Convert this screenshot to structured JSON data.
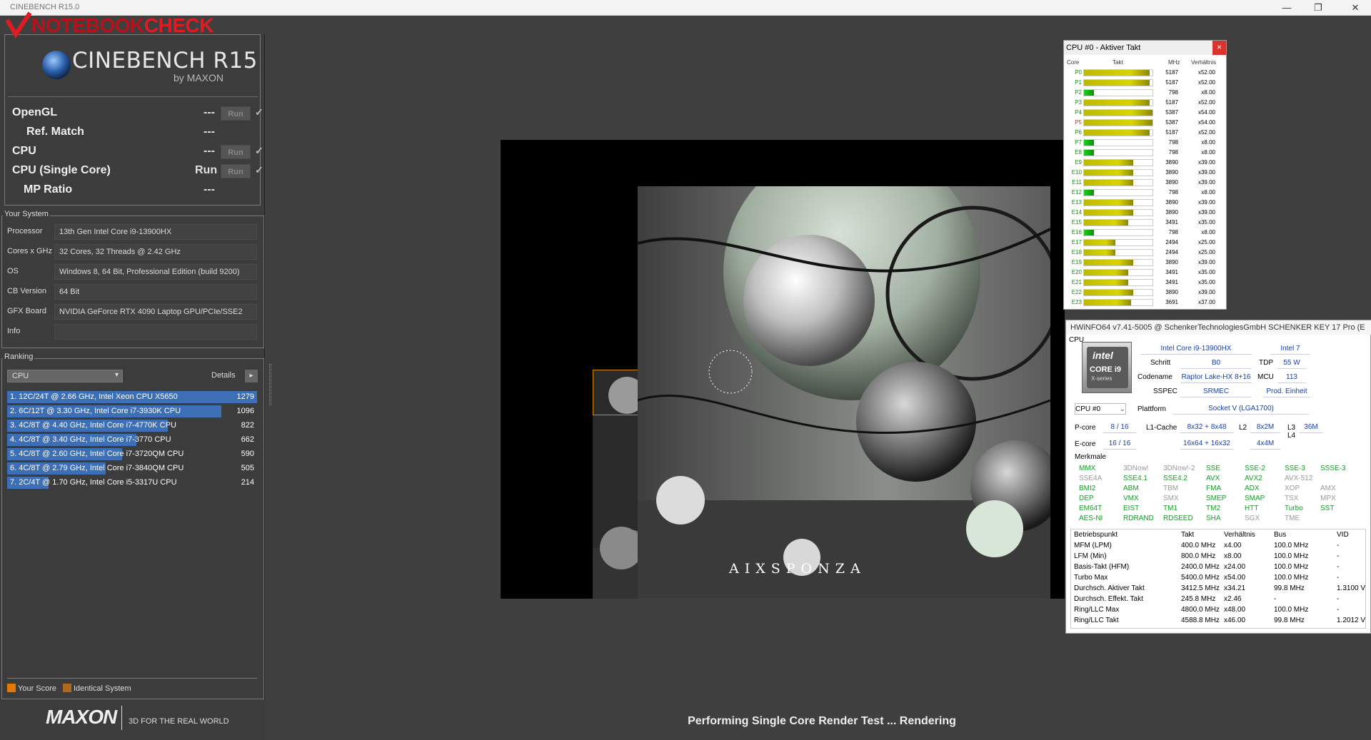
{
  "window": {
    "title": "CINEBENCH R15.0",
    "minimize": "—",
    "maximize": "❐",
    "close": "✕"
  },
  "watermark": {
    "text_a": "NOTEBOOK",
    "text_b": "CHECK"
  },
  "cinebench": {
    "title": "CINEBENCH R15",
    "subtitle": "by MAXON",
    "tests": [
      {
        "name": "OpenGL",
        "value": "---",
        "run": "Run"
      },
      {
        "name": "Ref. Match",
        "value": "---"
      },
      {
        "name": "CPU",
        "value": "---",
        "run": "Run"
      },
      {
        "name": "CPU (Single Core)",
        "value": "Run",
        "run": "Run"
      },
      {
        "name": "MP Ratio",
        "value": "---"
      }
    ],
    "check": "✓"
  },
  "your_system": {
    "label": "Your System",
    "rows": [
      {
        "k": "Processor",
        "v": "13th Gen Intel Core i9-13900HX"
      },
      {
        "k": "Cores x GHz",
        "v": "32 Cores, 32 Threads @ 2.42 GHz"
      },
      {
        "k": "OS",
        "v": "Windows 8, 64 Bit, Professional Edition (build 9200)"
      },
      {
        "k": "CB Version",
        "v": "64 Bit"
      },
      {
        "k": "GFX Board",
        "v": "NVIDIA GeForce RTX 4090 Laptop GPU/PCIe/SSE2"
      },
      {
        "k": "Info",
        "v": ""
      }
    ]
  },
  "ranking": {
    "label": "Ranking",
    "select": "CPU",
    "details": "Details",
    "rows": [
      {
        "text": "1. 12C/24T @ 2.66 GHz, Intel Xeon CPU X5650",
        "score": "1279",
        "fill": 1.0
      },
      {
        "text": "2. 6C/12T @ 3.30 GHz,  Intel Core i7-3930K CPU",
        "score": "1096",
        "fill": 0.857
      },
      {
        "text": "3. 4C/8T @ 4.40 GHz, Intel Core i7-4770K CPU",
        "score": "822",
        "fill": 0.643
      },
      {
        "text": "4. 4C/8T @ 3.40 GHz,  Intel Core i7-3770 CPU",
        "score": "662",
        "fill": 0.518
      },
      {
        "text": "5. 4C/8T @ 2.60 GHz, Intel Core i7-3720QM CPU",
        "score": "590",
        "fill": 0.461
      },
      {
        "text": "6. 4C/8T @ 2.79 GHz,  Intel Core i7-3840QM CPU",
        "score": "505",
        "fill": 0.395
      },
      {
        "text": "7. 2C/4T @ 1.70 GHz,  Intel Core i5-3317U CPU",
        "score": "214",
        "fill": 0.167
      }
    ],
    "legend_your": "Your Score",
    "legend_identical": "Identical System",
    "color_your": "#e07b00",
    "color_identical": "#b0681e"
  },
  "footer": {
    "logo": "MAXON",
    "tagline": "3D FOR THE REAL WORLD"
  },
  "render": {
    "brand": "AIXSPONZA",
    "status": "Performing Single Core Render Test ... Rendering"
  },
  "cpu_clock": {
    "title": "CPU #0 - Aktiver Takt",
    "close": "×",
    "headers": {
      "core": "Core",
      "takt": "Takt",
      "mhz": "MHz",
      "ratio": "Verhältnis"
    },
    "rows": [
      {
        "core": "P0",
        "mhz": "5187",
        "ratio": "x52.00",
        "fill": 0.96,
        "type": "p"
      },
      {
        "core": "P1",
        "mhz": "5187",
        "ratio": "x52.00",
        "fill": 0.96,
        "type": "p"
      },
      {
        "core": "P2",
        "mhz": "798",
        "ratio": "x8.00",
        "fill": 0.15,
        "type": "p"
      },
      {
        "core": "P3",
        "mhz": "5187",
        "ratio": "x52.00",
        "fill": 0.96,
        "type": "p"
      },
      {
        "core": "P4",
        "mhz": "5387",
        "ratio": "x54.00",
        "fill": 1.0,
        "type": "p"
      },
      {
        "core": "P5",
        "mhz": "5387",
        "ratio": "x54.00",
        "fill": 1.0,
        "type": "p_red"
      },
      {
        "core": "P6",
        "mhz": "5187",
        "ratio": "x52.00",
        "fill": 0.96,
        "type": "p"
      },
      {
        "core": "P7",
        "mhz": "798",
        "ratio": "x8.00",
        "fill": 0.15,
        "type": "p"
      },
      {
        "core": "E8",
        "mhz": "798",
        "ratio": "x8.00",
        "fill": 0.15,
        "type": "e"
      },
      {
        "core": "E9",
        "mhz": "3890",
        "ratio": "x39.00",
        "fill": 0.72,
        "type": "e"
      },
      {
        "core": "E10",
        "mhz": "3890",
        "ratio": "x39.00",
        "fill": 0.72,
        "type": "e"
      },
      {
        "core": "E11",
        "mhz": "3890",
        "ratio": "x39.00",
        "fill": 0.72,
        "type": "e"
      },
      {
        "core": "E12",
        "mhz": "798",
        "ratio": "x8.00",
        "fill": 0.15,
        "type": "e"
      },
      {
        "core": "E13",
        "mhz": "3890",
        "ratio": "x39.00",
        "fill": 0.72,
        "type": "e"
      },
      {
        "core": "E14",
        "mhz": "3890",
        "ratio": "x39.00",
        "fill": 0.72,
        "type": "e"
      },
      {
        "core": "E15",
        "mhz": "3491",
        "ratio": "x35.00",
        "fill": 0.65,
        "type": "e"
      },
      {
        "core": "E16",
        "mhz": "798",
        "ratio": "x8.00",
        "fill": 0.15,
        "type": "e"
      },
      {
        "core": "E17",
        "mhz": "2494",
        "ratio": "x25.00",
        "fill": 0.46,
        "type": "e"
      },
      {
        "core": "E18",
        "mhz": "2494",
        "ratio": "x25.00",
        "fill": 0.46,
        "type": "e"
      },
      {
        "core": "E19",
        "mhz": "3890",
        "ratio": "x39.00",
        "fill": 0.72,
        "type": "e"
      },
      {
        "core": "E20",
        "mhz": "3491",
        "ratio": "x35.00",
        "fill": 0.65,
        "type": "e"
      },
      {
        "core": "E21",
        "mhz": "3491",
        "ratio": "x35.00",
        "fill": 0.65,
        "type": "e"
      },
      {
        "core": "E22",
        "mhz": "3890",
        "ratio": "x39.00",
        "fill": 0.72,
        "type": "e"
      },
      {
        "core": "E23",
        "mhz": "3691",
        "ratio": "x37.00",
        "fill": 0.69,
        "type": "e"
      }
    ]
  },
  "hwinfo": {
    "title": "HWiNFO64 v7.41-5005 @ SchenkerTechnologiesGmbH SCHENKER KEY 17 Pro (E",
    "cpu_label": "CPU",
    "name": "Intel Core i9-13900HX",
    "node": "Intel 7",
    "badge": {
      "brand": "intel",
      "line": "CORE i9",
      "series": "X-series"
    },
    "schritt_k": "Schritt",
    "schritt_v": "B0",
    "tdp_k": "TDP",
    "tdp_v": "55 W",
    "codename_k": "Codename",
    "codename_v": "Raptor Lake-HX 8+16",
    "mcu_k": "MCU",
    "mcu_v": "113",
    "sspec_k": "SSPEC",
    "sspec_v": "SRMEC",
    "prod_v": "Prod. Einheit",
    "cpu_select": "CPU #0",
    "plattform_k": "Plattform",
    "plattform_v": "Socket V (LGA1700)",
    "pcore_k": "P-core",
    "pcore_v": "8 / 16",
    "l1_k": "L1-Cache",
    "l1_p": "8x32 + 8x48",
    "l1_e": "16x64 + 16x32",
    "l2_k": "L2",
    "l2_p": "8x2M",
    "l2_e": "4x4M",
    "l3_k": "L3",
    "l4_k": "L4",
    "l3_v": "36M",
    "ecore_k": "E-core",
    "ecore_v": "16 / 16",
    "features_label": "Merkmale",
    "features": [
      [
        "MMX",
        "on"
      ],
      [
        "3DNow!",
        "off"
      ],
      [
        "3DNow!-2",
        "off"
      ],
      [
        "SSE",
        "on"
      ],
      [
        "SSE-2",
        "on"
      ],
      [
        "SSE-3",
        "on"
      ],
      [
        "SSSE-3",
        "on"
      ],
      [
        "SSE4A",
        "off"
      ],
      [
        "SSE4.1",
        "on"
      ],
      [
        "SSE4.2",
        "on"
      ],
      [
        "AVX",
        "on"
      ],
      [
        "AVX2",
        "on"
      ],
      [
        "AVX-512",
        "off"
      ],
      [
        "",
        "off"
      ],
      [
        "BMI2",
        "on"
      ],
      [
        "ABM",
        "on"
      ],
      [
        "TBM",
        "off"
      ],
      [
        "FMA",
        "on"
      ],
      [
        "ADX",
        "on"
      ],
      [
        "XOP",
        "off"
      ],
      [
        "AMX",
        "off"
      ],
      [
        "DEP",
        "on"
      ],
      [
        "VMX",
        "on"
      ],
      [
        "SMX",
        "off"
      ],
      [
        "SMEP",
        "on"
      ],
      [
        "SMAP",
        "on"
      ],
      [
        "TSX",
        "off"
      ],
      [
        "MPX",
        "off"
      ],
      [
        "EM64T",
        "on"
      ],
      [
        "EIST",
        "on"
      ],
      [
        "TM1",
        "on"
      ],
      [
        "TM2",
        "on"
      ],
      [
        "HTT",
        "on"
      ],
      [
        "Turbo",
        "on"
      ],
      [
        "SST",
        "on"
      ],
      [
        "AES-NI",
        "on"
      ],
      [
        "RDRAND",
        "on"
      ],
      [
        "RDSEED",
        "on"
      ],
      [
        "SHA",
        "on"
      ],
      [
        "SGX",
        "off"
      ],
      [
        "TME",
        "off"
      ],
      [
        "",
        "off"
      ]
    ],
    "op_headers": [
      "Betriebspunkt",
      "Takt",
      "Verhältnis",
      "Bus",
      "VID"
    ],
    "op_rows": [
      [
        "MFM (LPM)",
        "400.0 MHz",
        "x4.00",
        "100.0 MHz",
        "-"
      ],
      [
        "LFM (Min)",
        "800.0 MHz",
        "x8.00",
        "100.0 MHz",
        "-"
      ],
      [
        "Basis-Takt (HFM)",
        "2400.0 MHz",
        "x24.00",
        "100.0 MHz",
        "-"
      ],
      [
        "Turbo Max",
        "5400.0 MHz",
        "x54.00",
        "100.0 MHz",
        "-"
      ],
      [
        "Durchsch. Aktiver Takt",
        "3412.5 MHz",
        "x34.21",
        "99.8 MHz",
        "1.3100 V"
      ],
      [
        "Durchsch. Effekt. Takt",
        "245.8 MHz",
        "x2.46",
        "-",
        "-"
      ],
      [
        "Ring/LLC Max",
        "4800.0 MHz",
        "x48.00",
        "100.0 MHz",
        "-"
      ],
      [
        "Ring/LLC Takt",
        "4588.8 MHz",
        "x46.00",
        "99.8 MHz",
        "1.2012 V"
      ]
    ]
  }
}
